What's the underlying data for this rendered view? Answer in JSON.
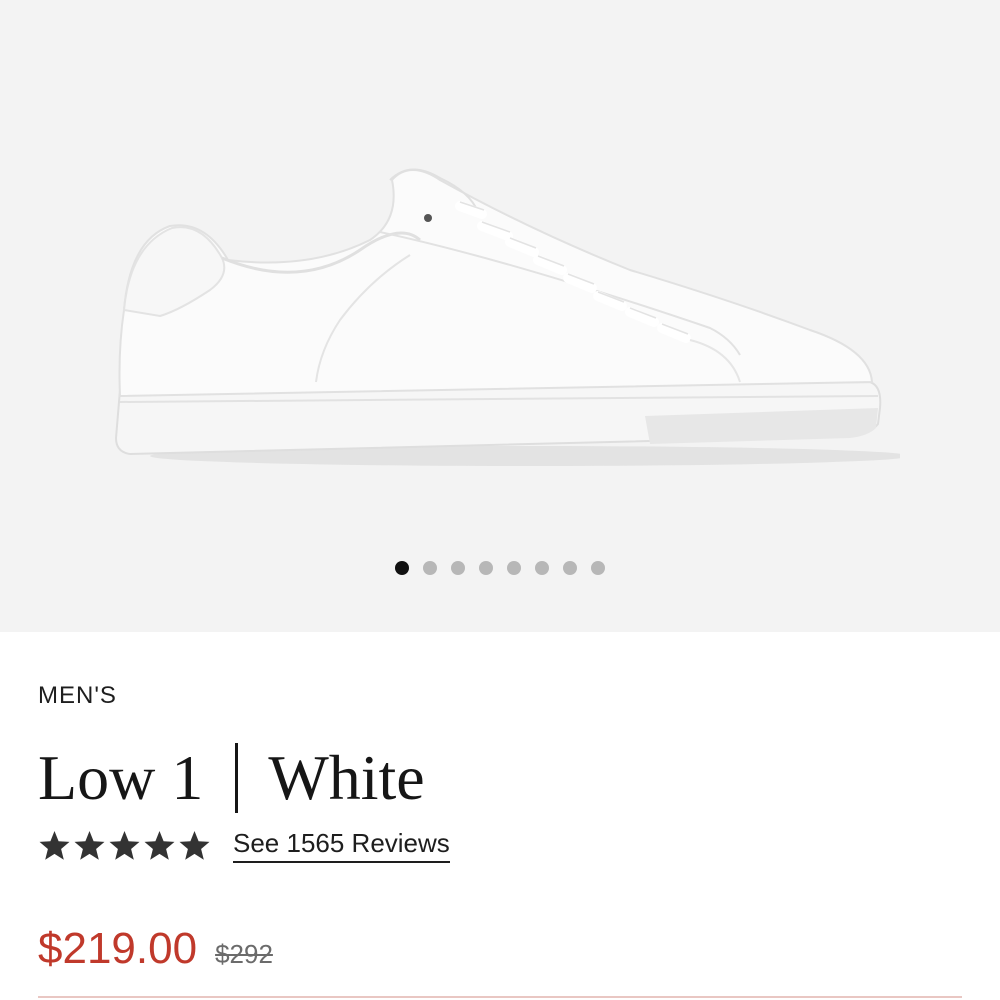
{
  "gallery": {
    "image_icon": "white-leather-sneaker-image",
    "dots_total": 8,
    "active_dot": 1
  },
  "product": {
    "category": "MEN'S",
    "name": "Low 1",
    "color_name": "White",
    "rating": 5,
    "reviews_link": "See 1565 Reviews",
    "price": "$219.00",
    "original_price": "$292"
  },
  "colors": {
    "gallery_bg": "#f3f3f3",
    "price": "#c0392b",
    "star": "#333333",
    "active_dot": "#111111",
    "inactive_dot": "#b7b7b7"
  }
}
